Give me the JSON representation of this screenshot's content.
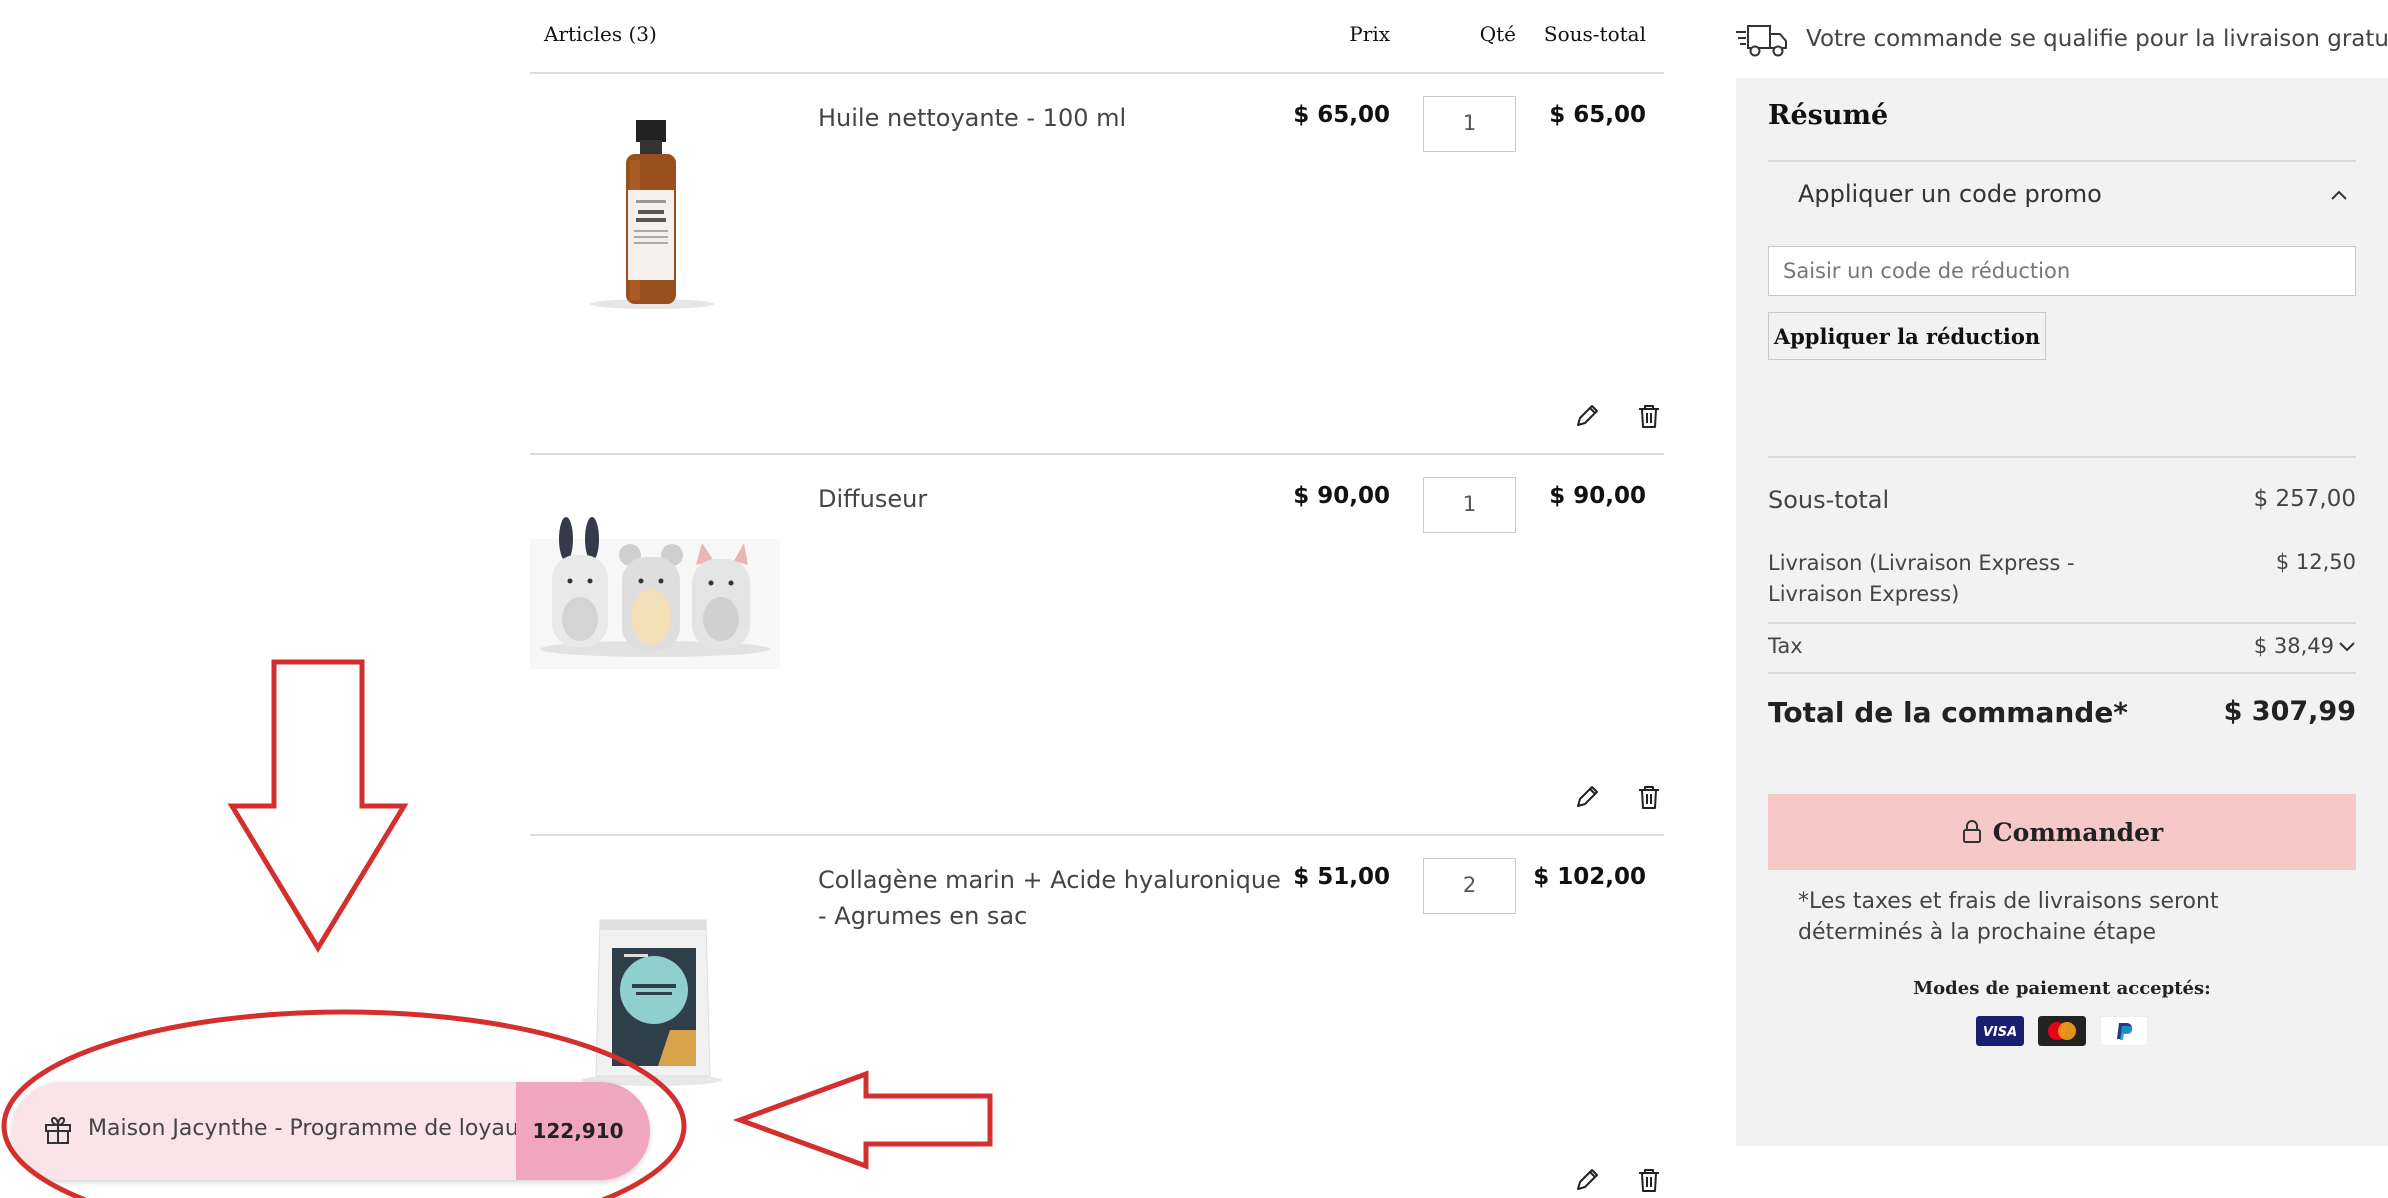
{
  "cart": {
    "columns": {
      "articles": "Articles (3)",
      "price": "Prix",
      "qty": "Qté",
      "subtotal": "Sous-total"
    },
    "items": [
      {
        "name": "Huile nettoyante - 100 ml",
        "price": "$ 65,00",
        "qty": "1",
        "subtotal": "$ 65,00",
        "image": "cleansing-oil-bottle"
      },
      {
        "name": "Diffuseur",
        "price": "$ 90,00",
        "qty": "1",
        "subtotal": "$ 90,00",
        "image": "animal-diffusers"
      },
      {
        "name": "Collagène marin + Acide hyaluronique - Agrumes en sac",
        "price": "$ 51,00",
        "qty": "2",
        "subtotal": "$ 102,00",
        "image": "collagen-pouch"
      }
    ],
    "item_actions": {
      "edit_icon": "pencil-icon",
      "delete_icon": "trash-icon"
    }
  },
  "shipping_notice": {
    "icon": "truck-icon",
    "text": "Votre commande se qualifie pour la livraison gratuite."
  },
  "summary": {
    "title": "Résumé",
    "promo": {
      "toggle_label": "Appliquer un code promo",
      "input_placeholder": "Saisir un code de réduction",
      "apply_label": "Appliquer la réduction"
    },
    "subtotal_label": "Sous-total",
    "subtotal_value": "$ 257,00",
    "shipping_label": "Livraison (Livraison Express - Livraison Express)",
    "shipping_value": "$ 12,50",
    "tax_label": "Tax",
    "tax_value": "$ 38,49",
    "total_label": "Total de la commande*",
    "total_value": "$ 307,99",
    "checkout_label": "Commander",
    "note": "*Les taxes et frais de livraisons seront déterminés à la prochaine étape",
    "payment_title": "Modes de paiement acceptés:",
    "payment_methods": [
      "visa-icon",
      "mastercard-icon",
      "paypal-icon"
    ],
    "checkout_color": "#f6c8c8"
  },
  "loyalty": {
    "icon": "gift-icon",
    "label": "Maison Jacynthe - Programme de loyauté",
    "points": "122,910 pts",
    "colors": {
      "background": "#fbe3ea",
      "points_background": "#f0a6bf"
    }
  },
  "annotation_color": "#d32f2f"
}
